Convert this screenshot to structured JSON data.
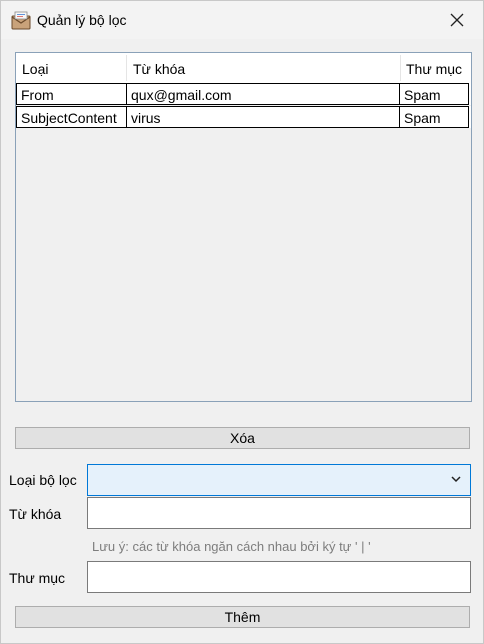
{
  "window": {
    "title": "Quản lý bộ lọc"
  },
  "table": {
    "columns": [
      "Loại",
      "Từ khóa",
      "Thư mục"
    ],
    "rows": [
      [
        "From",
        "qux@gmail.com",
        "Spam"
      ],
      [
        "SubjectContent",
        "virus",
        "Spam"
      ]
    ]
  },
  "buttons": {
    "delete": "Xóa",
    "add": "Thêm"
  },
  "form": {
    "filter_type_label": "Loại bộ lọc",
    "filter_type_value": "",
    "keyword_label": "Từ khóa",
    "keyword_value": "",
    "note": "Lưu ý: các từ khóa ngăn cách nhau bởi ký tự  ' | '",
    "folder_label": "Thư mục",
    "folder_value": ""
  }
}
